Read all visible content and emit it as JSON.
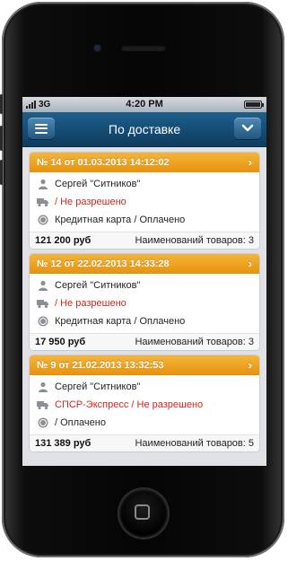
{
  "status_bar": {
    "carrier": "3G",
    "time": "4:20 PM"
  },
  "navbar": {
    "title": "По доставке",
    "menu_icon": "menu-icon",
    "dropdown_icon": "chevron-down-icon"
  },
  "orders": [
    {
      "header": "№ 14 от 01.03.2013 14:12:02",
      "customer": "Сергей \"Ситников\"",
      "delivery": "/ Не разрешено",
      "payment": "Кредитная карта / Оплачено",
      "total": "121 200 руб",
      "items": "Наименований товаров: 3"
    },
    {
      "header": "№ 12 от 22.02.2013 14:33:28",
      "customer": "Сергей \"Ситников\"",
      "delivery": "/ Не разрешено",
      "payment": "Кредитная карта / Оплачено",
      "total": "17 950 руб",
      "items": "Наименований товаров: 3"
    },
    {
      "header": "№ 9 от 21.02.2013 13:32:53",
      "customer": "Сергей \"Ситников\"",
      "delivery": "СПСР-Экспресс / Не разрешено",
      "payment": "/ Оплачено",
      "total": "131 389 руб",
      "items": "Наименований товаров: 5"
    }
  ],
  "colors": {
    "accent_orange": "#e6920f",
    "nav_blue": "#0e3c5e",
    "status_red": "#d0271d"
  }
}
